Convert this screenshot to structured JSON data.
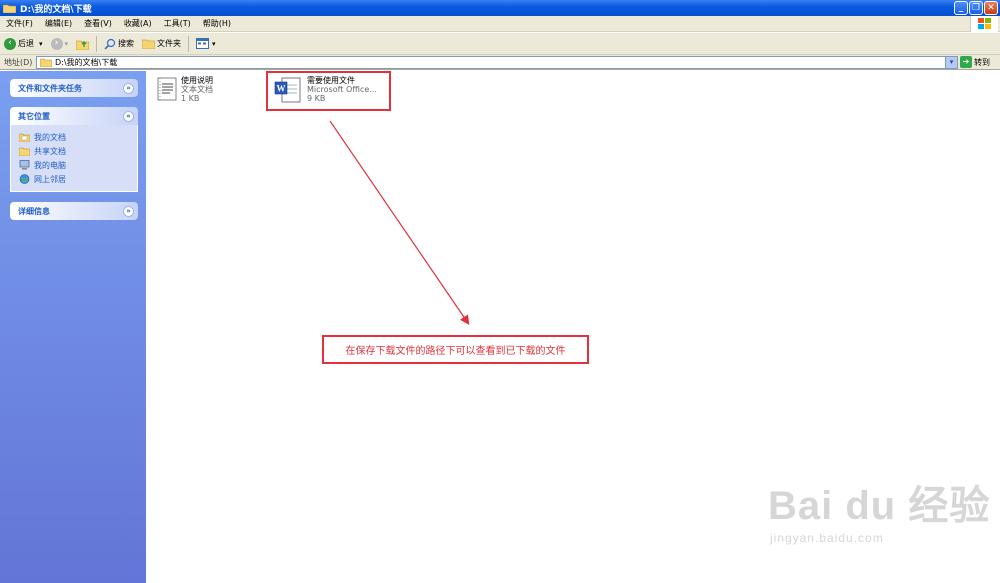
{
  "window": {
    "title": "D:\\我的文档\\下载"
  },
  "menu": [
    "文件(F)",
    "编辑(E)",
    "查看(V)",
    "收藏(A)",
    "工具(T)",
    "帮助(H)"
  ],
  "toolbar": {
    "back": "后退",
    "search": "搜索",
    "folders": "文件夹"
  },
  "address": {
    "label": "地址(D)",
    "path": "D:\\我的文档\\下载",
    "go": "转到"
  },
  "panels": {
    "tasks": {
      "title": "文件和文件夹任务"
    },
    "places": {
      "title": "其它位置",
      "items": [
        "我的文档",
        "共享文档",
        "我的电脑",
        "网上邻居"
      ]
    },
    "details": {
      "title": "详细信息"
    }
  },
  "files": [
    {
      "name": "使用说明",
      "type": "文本文档",
      "size": "1 KB",
      "icon": "text-file-icon"
    },
    {
      "name": "需要使用文件",
      "type": "Microsoft Office...",
      "size": "9 KB",
      "icon": "word-document-icon"
    }
  ],
  "annotation": {
    "text": "在保存下载文件的路径下可以查看到已下载的文件",
    "color": "#e3303a"
  },
  "watermark": {
    "main": "Bai du 经验",
    "url": "jingyan.baidu.com"
  },
  "colors": {
    "titlebar": "#0753d8",
    "sidebar": "#7a9ff0",
    "accent": "#215dc6"
  }
}
